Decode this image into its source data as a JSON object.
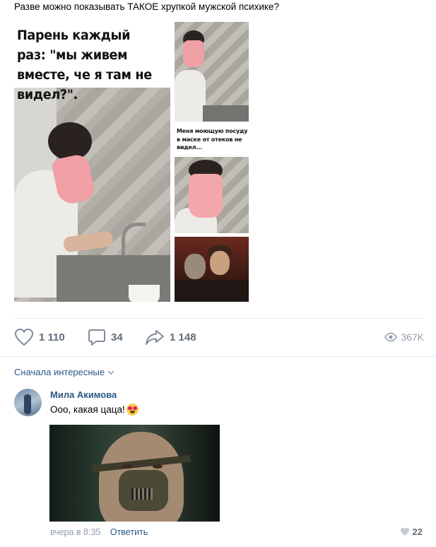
{
  "post": {
    "text": "Разве можно показывать ТАКОЕ хрупкой мужской психике?",
    "main_photo_caption": "Парень каждый раз: \"мы живем вместе, че я там не видел?\".",
    "side_photo_caption": "Меня моющую посуду в маске от отеков не видел..."
  },
  "actions": {
    "likes": "1 110",
    "comments": "34",
    "shares": "1 148",
    "views": "367K"
  },
  "comments_section": {
    "sort_label": "Сначала интересные"
  },
  "comment": {
    "author": "Мила Акимова",
    "text": "Ооо, какая цаца!",
    "time": "вчера в 8:35",
    "reply_label": "Ответить",
    "likes": "22"
  },
  "colors": {
    "link": "#2a5885",
    "icon": "#818c99",
    "divider": "#e7e8ec"
  }
}
